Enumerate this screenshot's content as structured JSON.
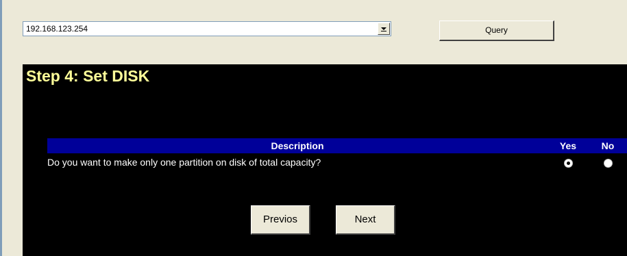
{
  "toolbar": {
    "host": "192.168.123.254",
    "query_label": "Query"
  },
  "wizard": {
    "title": "Step 4: Set DISK",
    "table": {
      "headers": [
        "Description",
        "Yes",
        "No"
      ],
      "rows": [
        {
          "question": "Do you want to make only one partition on disk of total capacity?",
          "selected": "Yes"
        }
      ]
    },
    "buttons": {
      "previous": "Previos",
      "next": "Next"
    }
  },
  "colors": {
    "panel_bg": "#000000",
    "title": "#ffff99",
    "header_bg": "#000099",
    "window_bg": "#ece9d8"
  }
}
